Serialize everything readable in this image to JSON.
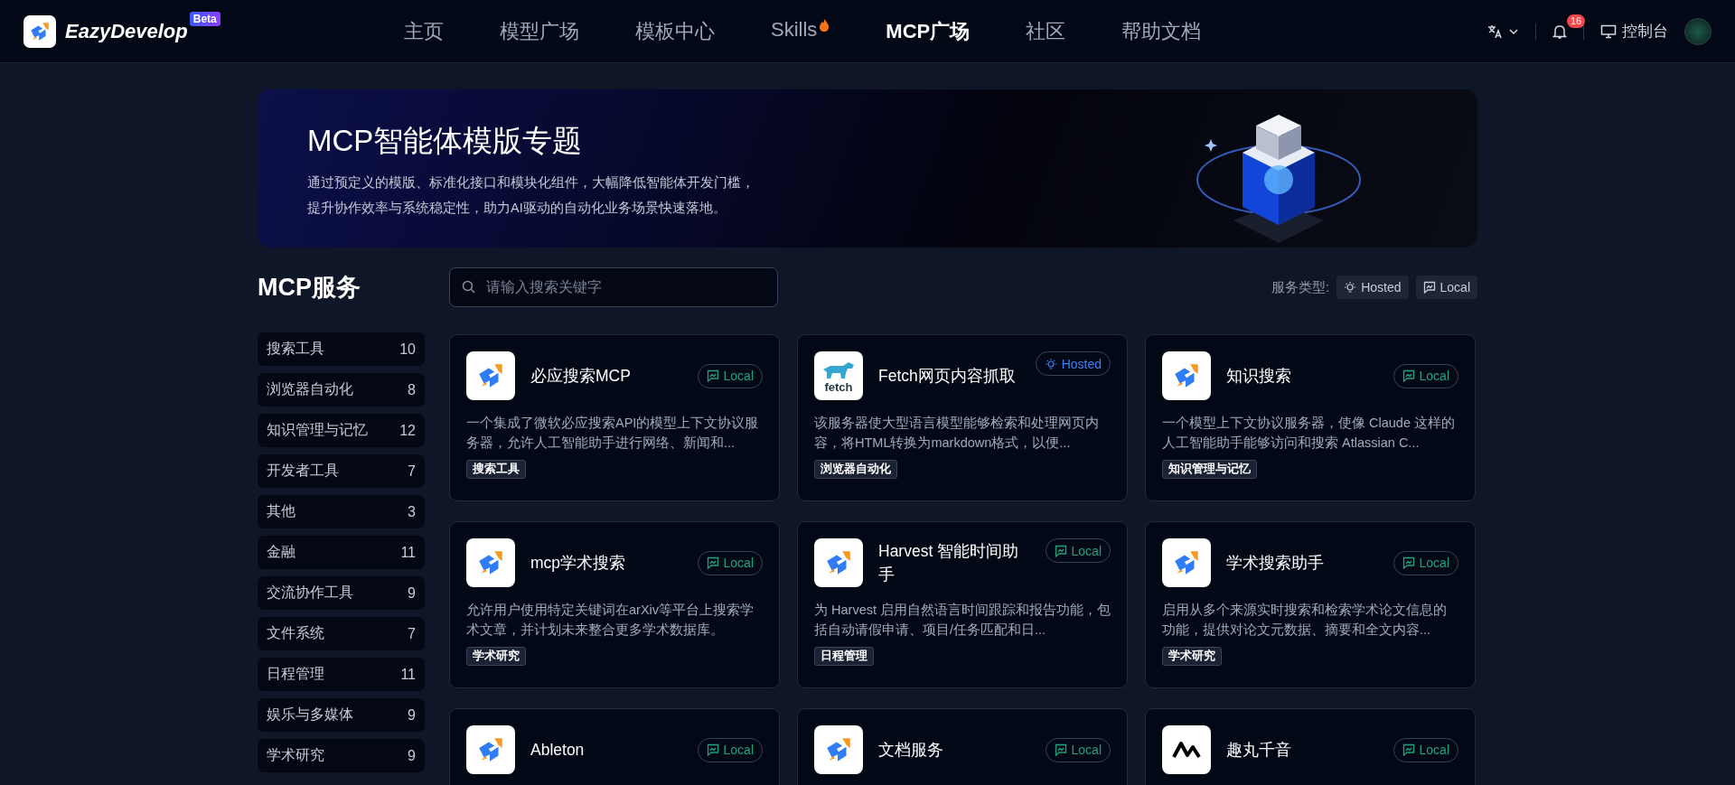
{
  "header": {
    "logo_text": "EazyDevelop",
    "beta_badge": "Beta",
    "nav": [
      {
        "label": "主页",
        "selected": false
      },
      {
        "label": "模型广场",
        "selected": false
      },
      {
        "label": "模板中心",
        "selected": false
      },
      {
        "label": "Skills",
        "selected": false,
        "hot": true
      },
      {
        "label": "MCP广场",
        "selected": true
      },
      {
        "label": "社区",
        "selected": false
      },
      {
        "label": "帮助文档",
        "selected": false
      }
    ],
    "notification_count": "16",
    "console_label": "控制台"
  },
  "banner": {
    "title": "MCP智能体模版专题",
    "lines": [
      "通过预定义的模版、标准化接口和模块化组件，大幅降低智能体开发门槛，",
      "提升协作效率与系统稳定性，助力AI驱动的自动化业务场景快速落地。"
    ]
  },
  "sidebar": {
    "title": "MCP服务",
    "items": [
      {
        "label": "搜索工具",
        "count": "10"
      },
      {
        "label": "浏览器自动化",
        "count": "8"
      },
      {
        "label": "知识管理与记忆",
        "count": "12"
      },
      {
        "label": "开发者工具",
        "count": "7"
      },
      {
        "label": "其他",
        "count": "3"
      },
      {
        "label": "金融",
        "count": "11"
      },
      {
        "label": "交流协作工具",
        "count": "9"
      },
      {
        "label": "文件系统",
        "count": "7"
      },
      {
        "label": "日程管理",
        "count": "11"
      },
      {
        "label": "娱乐与多媒体",
        "count": "9"
      },
      {
        "label": "学术研究",
        "count": "9"
      }
    ]
  },
  "search": {
    "placeholder": "请输入搜索关键字"
  },
  "service_type": {
    "label": "服务类型:",
    "options": [
      {
        "label": "Hosted",
        "kind": "hosted"
      },
      {
        "label": "Local",
        "kind": "local"
      }
    ]
  },
  "cards": [
    {
      "logo": {
        "kind": "eazy"
      },
      "name": "必应搜索MCP",
      "kind": "local",
      "type_label": "Local",
      "description": "一个集成了微软必应搜索API的模型上下文协议服务器，允许人工智能助手进行网络、新闻和...",
      "tag": "搜索工具"
    },
    {
      "logo": {
        "kind": "fetch"
      },
      "name": "Fetch网页内容抓取",
      "kind": "hosted",
      "type_label": "Hosted",
      "description": "该服务器使大型语言模型能够检索和处理网页内容，将HTML转换为markdown格式，以便...",
      "tag": "浏览器自动化"
    },
    {
      "logo": {
        "kind": "eazy"
      },
      "name": "知识搜索",
      "kind": "local",
      "type_label": "Local",
      "description": "一个模型上下文协议服务器，使像 Claude 这样的人工智能助手能够访问和搜索 Atlassian C...",
      "tag": "知识管理与记忆"
    },
    {
      "logo": {
        "kind": "eazy"
      },
      "name": "mcp学术搜索",
      "kind": "local",
      "type_label": "Local",
      "description": "允许用户使用特定关键词在arXiv等平台上搜索学术文章，并计划未来整合更多学术数据库。",
      "tag": "学术研究"
    },
    {
      "logo": {
        "kind": "eazy"
      },
      "name": "Harvest 智能时间助手",
      "kind": "local",
      "type_label": "Local",
      "description": "为 Harvest 启用自然语言时间跟踪和报告功能，包括自动请假申请、项目/任务匹配和日...",
      "tag": "日程管理"
    },
    {
      "logo": {
        "kind": "eazy"
      },
      "name": "学术搜索助手",
      "kind": "local",
      "type_label": "Local",
      "description": "启用从多个来源实时搜索和检索学术论文信息的功能，提供对论文元数据、摘要和全文内容...",
      "tag": "学术研究"
    },
    {
      "logo": {
        "kind": "eazy"
      },
      "name": "Ableton",
      "kind": "local",
      "type_label": "Local"
    },
    {
      "logo": {
        "kind": "eazy"
      },
      "name": "文档服务",
      "kind": "local",
      "type_label": "Local"
    },
    {
      "logo": {
        "kind": "wave"
      },
      "name": "趣丸千音",
      "kind": "local",
      "type_label": "Local"
    }
  ]
}
